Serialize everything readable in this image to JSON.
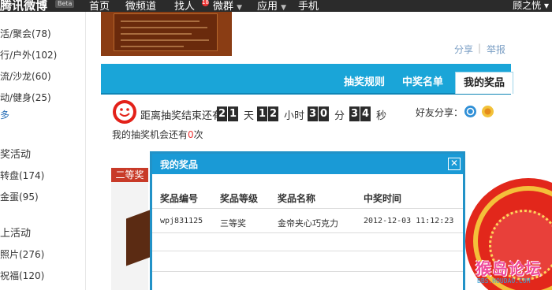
{
  "topbar": {
    "logo": "腾讯微博",
    "beta": "Beta",
    "nav": [
      "首页",
      "微频道",
      "找人",
      "微群",
      "应用",
      "手机"
    ],
    "badge": "18",
    "user": "顾之恍 ▾"
  },
  "sidebar": {
    "items": [
      "活/聚会(78)",
      "行/户外(102)",
      "流/沙龙(60)",
      "动/健身(25)",
      "多"
    ],
    "section1": "奖活动",
    "section1_items": [
      "转盘(174)",
      "金蛋(95)"
    ],
    "section2": "上活动",
    "section2_items": [
      "照片(276)",
      "祝福(120)"
    ]
  },
  "links": {
    "share": "分享",
    "report": "举报"
  },
  "tabs": [
    {
      "label": "抽奖规则"
    },
    {
      "label": "中奖名单"
    },
    {
      "label": "我的奖品"
    }
  ],
  "countdown": {
    "prefix": "距离抽奖结束还有",
    "days": [
      "2",
      "1"
    ],
    "day_unit": "天",
    "hours": [
      "1",
      "2"
    ],
    "hour_unit": "小时",
    "minutes": [
      "3",
      "0"
    ],
    "minute_unit": "分",
    "seconds": [
      "3",
      "4"
    ],
    "second_unit": "秒"
  },
  "chances": {
    "prefix": "我的抽奖机会还有",
    "count": "0",
    "suffix": "次"
  },
  "friend_share": "好友分享：",
  "prize_tag": "二等奖",
  "modal": {
    "title": "我的奖品",
    "close": "✕",
    "headers": [
      "奖品编号",
      "奖品等级",
      "奖品名称",
      "中奖时间"
    ],
    "rows": [
      [
        "wpj831125",
        "三等奖",
        "金帝夹心巧克力",
        "2012-12-03 11:12:23"
      ]
    ]
  },
  "watermark": {
    "main": "猴岛论坛",
    "sub": "BBS.HOUDAO.COM"
  },
  "colors": {
    "tab_bg": "#1aa5d8",
    "modal_border": "#2292c7",
    "accent_red": "#e32119"
  }
}
